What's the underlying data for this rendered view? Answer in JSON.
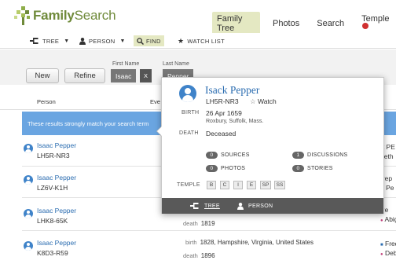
{
  "logo": {
    "text_bold": "Family",
    "text_rest": "Search"
  },
  "topnav": {
    "items": [
      "Family Tree",
      "Photos",
      "Search",
      "Temple"
    ]
  },
  "subnav": {
    "tree": "TREE",
    "person": "PERSON",
    "find": "FIND",
    "watch_list": "WATCH LIST"
  },
  "filters": {
    "new_label": "New",
    "refine_label": "Refine",
    "first_name_label": "First Name",
    "first_name_value": "Isaac",
    "last_name_label": "Last Name",
    "last_name_value": "Pepper",
    "remove_glyph": "X"
  },
  "table": {
    "col_person": "Person",
    "col_events": "Eve",
    "banner": "These results strongly match your search term"
  },
  "rows": [
    {
      "name": "Isaac Pepper",
      "id": "LH5R-NR3",
      "rel1": "rt PE",
      "rel2": "beth"
    },
    {
      "name": "Isaac Pepper",
      "id": "LZ6V-K1H",
      "rel1": "Pep",
      "rel2": "a Pe"
    },
    {
      "name": "Isaac Pepper",
      "id": "LHK8-65K",
      "death_label": "death",
      "death_value": "1819",
      "rel1": "Pe",
      "rel2": "Abigail Fo"
    },
    {
      "name": "Isaac Pepper",
      "id": "K8D3-R59",
      "birth_label": "birth",
      "birth_value": "1828, Hampshire, Virginia, United States",
      "death_label": "death",
      "death_value": "1896",
      "rel1": "Frederick",
      "rel2": "Deborah"
    }
  ],
  "popover": {
    "name": "Isack Pepper",
    "id": "LH5R-NR3",
    "watch": "Watch",
    "birth_label": "BIRTH",
    "birth_date": "26 Apr 1659",
    "birth_place": "Roxbury, Suffolk, Mass.",
    "death_label": "DEATH",
    "death_value": "Deceased",
    "sources_count": "0",
    "sources_label": "SOURCES",
    "discussions_count": "1",
    "discussions_label": "DISCUSSIONS",
    "photos_count": "0",
    "photos_label": "PHOTOS",
    "stories_count": "0",
    "stories_label": "STORIES",
    "temple_label": "TEMPLE",
    "ordinances": [
      "B",
      "C",
      "I",
      "E",
      "SP",
      "SS"
    ],
    "footer_tree": "TREE",
    "footer_person": "PERSON"
  },
  "colors": {
    "brand_green": "#6f8a3a",
    "link_blue": "#2a6cb0",
    "banner_blue": "#6aa5e1",
    "active_tab": "#e4e8c2"
  }
}
